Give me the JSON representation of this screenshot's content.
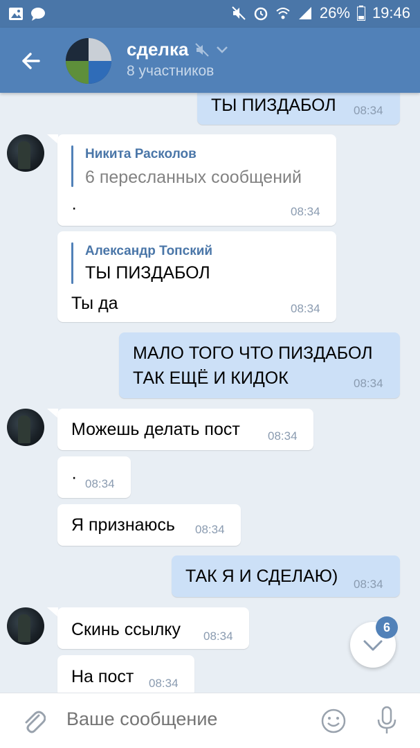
{
  "status_bar": {
    "battery": "26%",
    "time": "19:46"
  },
  "header": {
    "title": "сделка",
    "subtitle": "8 участников"
  },
  "messages": [
    {
      "text": "ТЫ ПИЗДАБОЛ",
      "time": "08:34"
    },
    {
      "forward_author": "Никита Расколов",
      "forward_text": "6 пересланных сообщений",
      "text": "·",
      "time": "08:34"
    },
    {
      "forward_author": "Александр Топский",
      "forward_text": "ТЫ ПИЗДАБОЛ",
      "text": "Ты да",
      "time": "08:34"
    },
    {
      "text_line1": "МАЛО ТОГО ЧТО ПИЗДАБОЛ",
      "text_line2": "ТАК ЕЩЁ И КИДОК",
      "time": "08:34"
    },
    {
      "text": "Можешь делать пост",
      "time": "08:34"
    },
    {
      "text": "·",
      "time": "08:34"
    },
    {
      "text": "Я признаюсь",
      "time": "08:34"
    },
    {
      "text": "ТАК Я И СДЕЛАЮ)",
      "time": "08:34"
    },
    {
      "text": "Скинь ссылку",
      "time": "08:34"
    },
    {
      "text": "На пост",
      "time": "08:34"
    }
  ],
  "fab": {
    "badge": "6"
  },
  "input": {
    "placeholder": "Ваше сообщение"
  },
  "icons": {
    "back": "arrow-left-icon",
    "mute": "muted-speaker-icon",
    "dropdown": "chevron-down-icon",
    "attach": "paperclip-icon",
    "emoji": "smiley-icon",
    "mic": "microphone-icon",
    "scroll": "chevron-down-icon"
  },
  "colors": {
    "header": "#5181b8",
    "status_bar": "#4a76a8",
    "incoming_bubble": "#ffffff",
    "outgoing_bubble": "#cce0f7",
    "background": "#e8eef4"
  }
}
